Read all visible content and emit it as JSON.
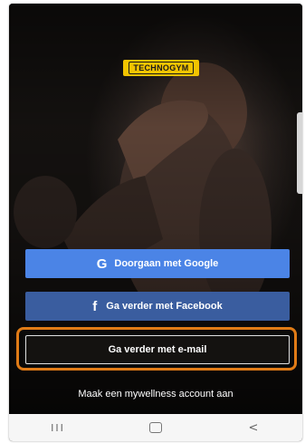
{
  "brand": {
    "logo_text": "TECHNOGYM",
    "logo_bg": "#f2c400"
  },
  "auth": {
    "google_label": "Doorgaan met Google",
    "google_icon": "G",
    "facebook_label": "Ga verder met Facebook",
    "facebook_icon": "f",
    "email_label": "Ga verder met e-mail",
    "create_account_label": "Maak een mywellness account aan"
  },
  "colors": {
    "google_button": "#4b84e6",
    "facebook_button": "#3a5d9f",
    "highlight_outline": "#e07b16"
  },
  "navbar": {
    "recents_glyph": "III",
    "back_glyph": "<"
  }
}
